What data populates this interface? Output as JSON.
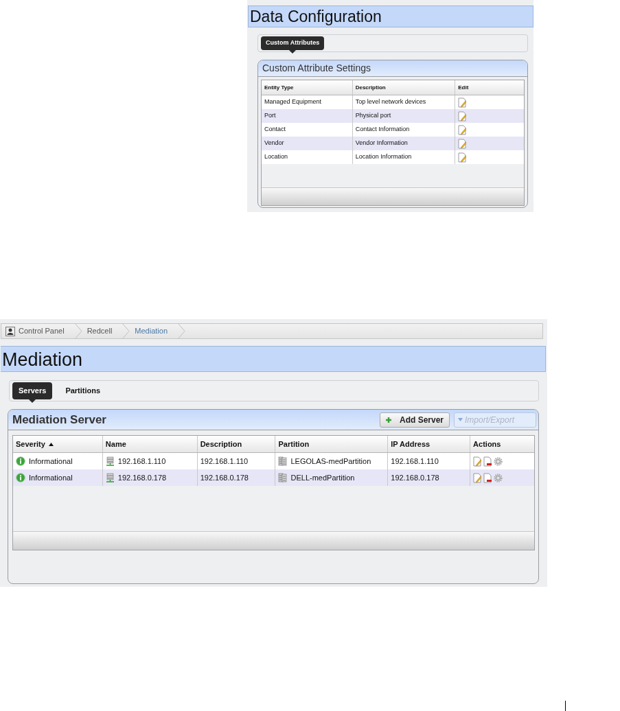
{
  "data_configuration": {
    "title": "Data Configuration",
    "tabs": [
      {
        "label": "Custom Attributes",
        "selected": true
      }
    ],
    "panel": {
      "title": "Custom Attribute Settings",
      "columns": [
        "Entity Type",
        "Description",
        "Edit"
      ],
      "rows": [
        {
          "entity_type": "Managed Equipment",
          "description": "Top level network devices"
        },
        {
          "entity_type": "Port",
          "description": "Physical port"
        },
        {
          "entity_type": "Contact",
          "description": "Contact Information"
        },
        {
          "entity_type": "Vendor",
          "description": "Vendor Information"
        },
        {
          "entity_type": "Location",
          "description": "Location Information"
        }
      ]
    }
  },
  "mediation": {
    "breadcrumb": [
      {
        "label": "Control Panel",
        "selected": false
      },
      {
        "label": "Redcell",
        "selected": false
      },
      {
        "label": "Mediation",
        "selected": true
      }
    ],
    "title": "Mediation",
    "tabs": [
      {
        "label": "Servers",
        "selected": true
      },
      {
        "label": "Partitions",
        "selected": false
      }
    ],
    "panel": {
      "title": "Mediation Server",
      "buttons": [
        {
          "label": "Add Server",
          "kind": "add",
          "disabled": false
        },
        {
          "label": "Import/Export",
          "kind": "menu",
          "disabled": true
        }
      ],
      "columns": [
        {
          "label": "Severity",
          "sorted": true
        },
        {
          "label": "Name",
          "sorted": false
        },
        {
          "label": "Description",
          "sorted": false
        },
        {
          "label": "Partition",
          "sorted": false
        },
        {
          "label": "IP Address",
          "sorted": false
        },
        {
          "label": "Actions",
          "sorted": false
        }
      ],
      "rows": [
        {
          "severity": "Informational",
          "name": "192.168.1.110",
          "description": "192.168.1.110",
          "partition": "LEGOLAS-medPartition",
          "ip_address": "192.168.1.110"
        },
        {
          "severity": "Informational",
          "name": "192.168.0.178",
          "description": "192.168.0.178",
          "partition": "DELL-medPartition",
          "ip_address": "192.168.0.178"
        }
      ]
    }
  }
}
